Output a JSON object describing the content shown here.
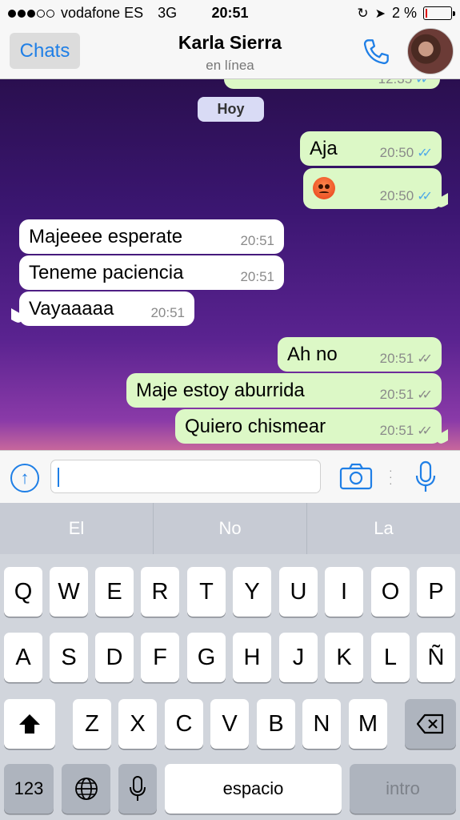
{
  "status_bar": {
    "carrier": "vodafone ES",
    "network": "3G",
    "time": "20:51",
    "battery": "2 %"
  },
  "header": {
    "back_label": "Chats",
    "contact_name": "Karla Sierra",
    "contact_status": "en línea"
  },
  "chat": {
    "date_badge": "Hoy",
    "partial_time": "12:35",
    "messages": [
      {
        "dir": "out",
        "text": "Aja",
        "time": "20:50",
        "ticks": "read"
      },
      {
        "dir": "out",
        "text": "",
        "emoji": "angry-face",
        "time": "20:50",
        "ticks": "read"
      },
      {
        "dir": "in",
        "text": "Majeeee esperate",
        "time": "20:51"
      },
      {
        "dir": "in",
        "text": "Teneme paciencia",
        "time": "20:51"
      },
      {
        "dir": "in",
        "text": "Vayaaaaa",
        "time": "20:51"
      },
      {
        "dir": "out",
        "text": "Ah no",
        "time": "20:51",
        "ticks": "delivered"
      },
      {
        "dir": "out",
        "text": "Maje estoy aburrida",
        "time": "20:51",
        "ticks": "delivered"
      },
      {
        "dir": "out",
        "text": "Quiero chismear",
        "time": "20:51",
        "ticks": "delivered"
      }
    ]
  },
  "input": {
    "value": "",
    "placeholder": ""
  },
  "suggestions": [
    "El",
    "No",
    "La"
  ],
  "keyboard": {
    "row1": [
      "Q",
      "W",
      "E",
      "R",
      "T",
      "Y",
      "U",
      "I",
      "O",
      "P"
    ],
    "row2": [
      "A",
      "S",
      "D",
      "F",
      "G",
      "H",
      "J",
      "K",
      "L",
      "Ñ"
    ],
    "row3": [
      "Z",
      "X",
      "C",
      "V",
      "B",
      "N",
      "M"
    ],
    "numbers_label": "123",
    "space_label": "espacio",
    "return_label": "intro"
  },
  "colors": {
    "accent": "#1f7fe6",
    "outgoing_bubble": "#dcf8c6",
    "incoming_bubble": "#ffffff",
    "read_ticks": "#4fa9e8"
  }
}
